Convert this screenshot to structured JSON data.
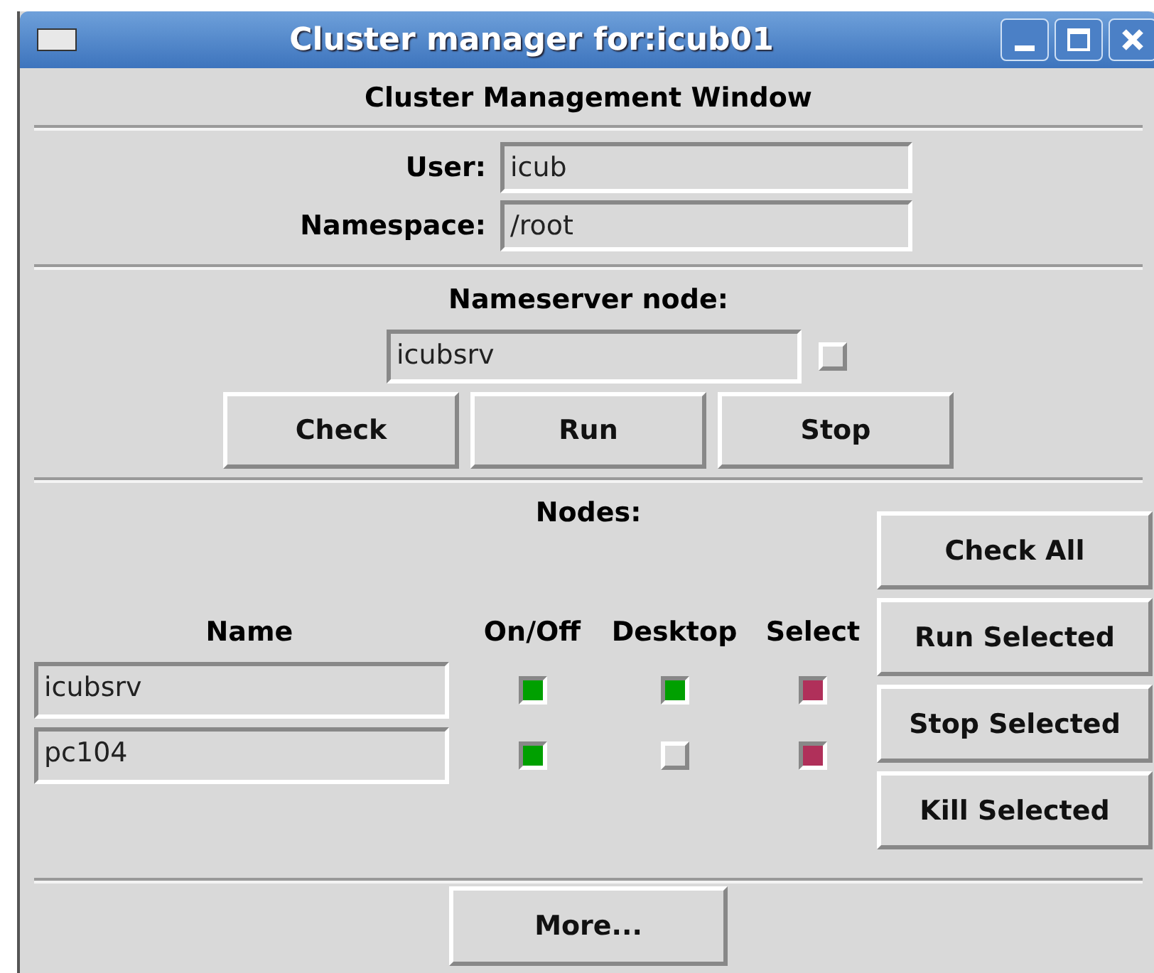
{
  "window": {
    "title": "Cluster manager for:icub01"
  },
  "header": "Cluster Management Window",
  "user": {
    "label": "User:",
    "value": "icub"
  },
  "namespace": {
    "label": "Namespace:",
    "value": "/root"
  },
  "nameserver": {
    "label": "Nameserver node:",
    "value": "icubsrv",
    "checked": false,
    "buttons": [
      "Check",
      "Run",
      "Stop"
    ]
  },
  "nodes": {
    "label": "Nodes:",
    "columns": [
      "Name",
      "On/Off",
      "Desktop",
      "Select"
    ],
    "rows": [
      {
        "name": "icubsrv",
        "on": true,
        "desktop": true,
        "select": true
      },
      {
        "name": "pc104",
        "on": true,
        "desktop": false,
        "select": true
      }
    ],
    "buttons": [
      "Check All",
      "Run Selected",
      "Stop Selected",
      "Kill Selected"
    ]
  },
  "more_button": "More..."
}
